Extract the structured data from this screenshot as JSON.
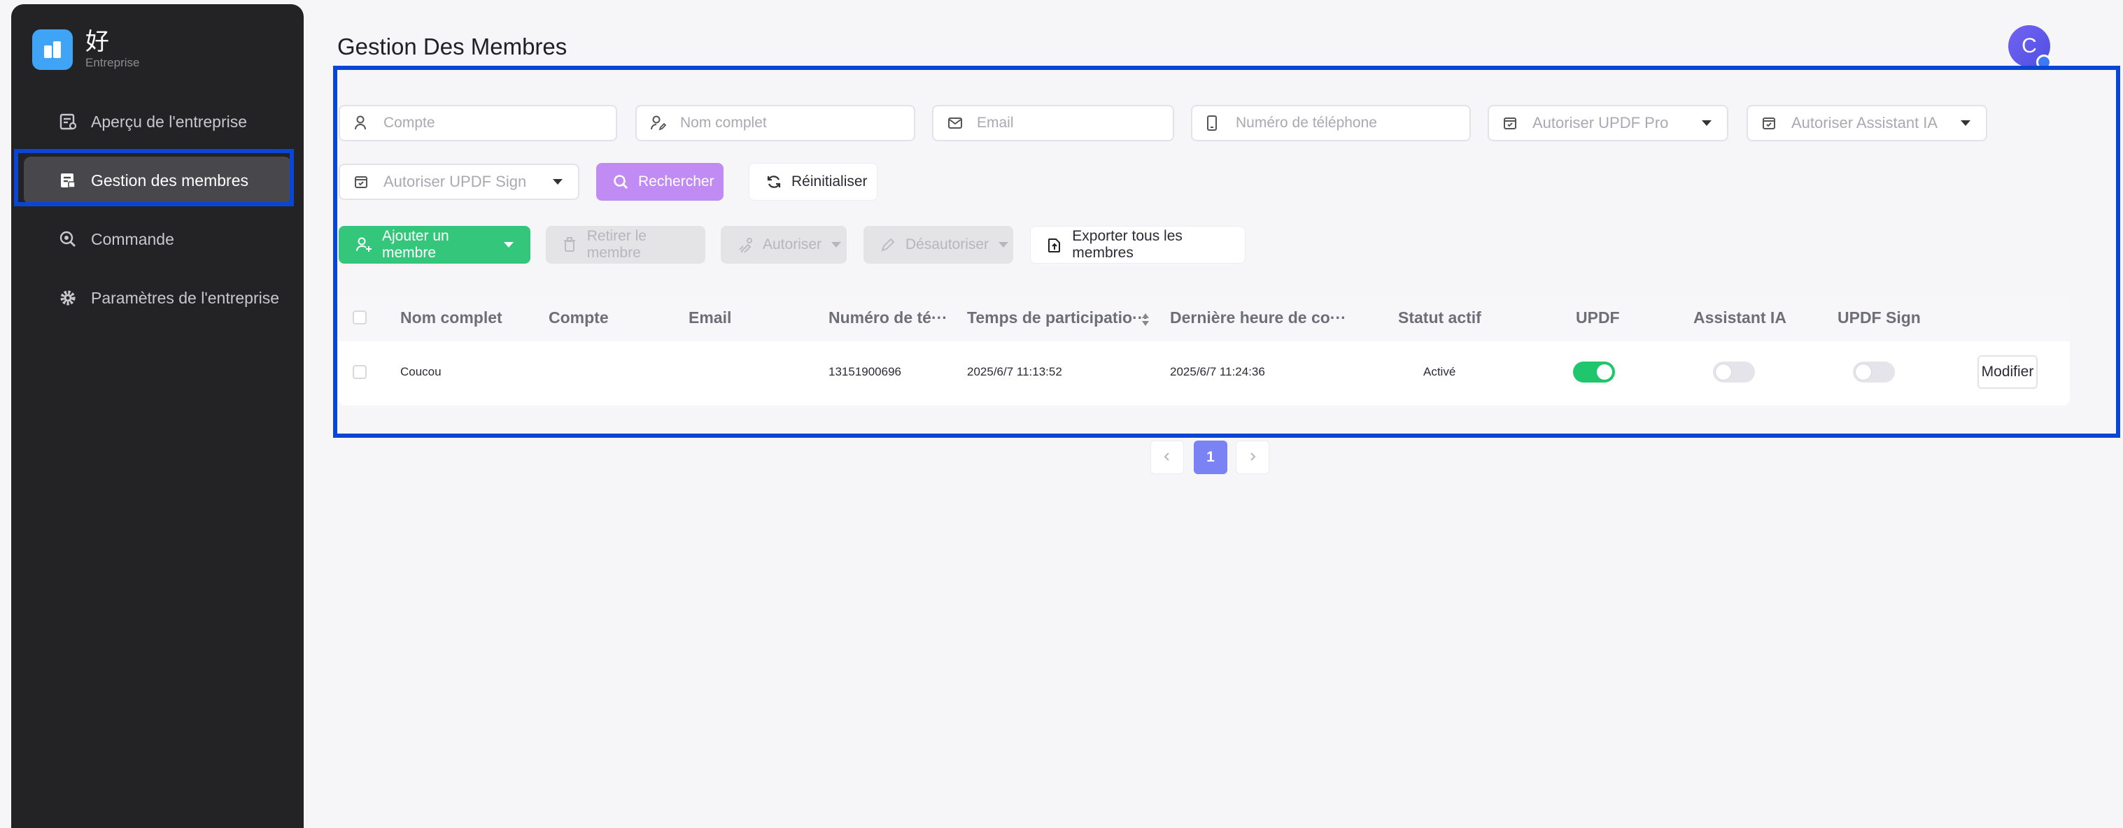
{
  "sidebar": {
    "logo": {
      "name": "好",
      "sub": "Entreprise"
    },
    "items": [
      {
        "label": "Aperçu de l'entreprise",
        "icon": "dashboard-icon"
      },
      {
        "label": "Gestion des membres",
        "icon": "members-icon",
        "active": true
      },
      {
        "label": "Commande",
        "icon": "order-search-icon"
      },
      {
        "label": "Paramètres de l'entreprise",
        "icon": "gear-icon"
      }
    ]
  },
  "header": {
    "title": "Gestion Des Membres",
    "avatar_initial": "C"
  },
  "filters": {
    "account_placeholder": "Compte",
    "fullname_placeholder": "Nom complet",
    "email_placeholder": "Email",
    "phone_placeholder": "Numéro de téléphone",
    "updf_pro": "Autoriser UPDF Pro",
    "ai_assistant": "Autoriser Assistant IA",
    "updf_sign": "Autoriser UPDF Sign",
    "search_label": "Rechercher",
    "reset_label": "Réinitialiser"
  },
  "actions": {
    "add_member": "Ajouter un membre",
    "remove_member": "Retirer le membre",
    "authorize": "Autoriser",
    "deauthorize": "Désautoriser",
    "export_all": "Exporter tous les membres"
  },
  "table": {
    "columns": {
      "fullname": "Nom complet",
      "account": "Compte",
      "email": "Email",
      "phone": "Numéro de té···",
      "join_time": "Temps de participatio···",
      "last_login": "Dernière heure de co···",
      "status": "Statut actif",
      "updf": "UPDF",
      "ai": "Assistant IA",
      "sign": "UPDF Sign"
    },
    "rows": [
      {
        "fullname": "Coucou",
        "account": "",
        "email": "",
        "phone": "13151900696",
        "join_time": "2025/6/7 11:13:52",
        "last_login": "2025/6/7 11:24:36",
        "status": "Activé",
        "updf": true,
        "ai": false,
        "sign": false,
        "edit_label": "Modifier"
      }
    ]
  },
  "pagination": {
    "current": "1"
  },
  "colors": {
    "accent": "#7b82f3",
    "green": "#34c77b",
    "purple": "#c08cf4",
    "highlight": "#0a46d6"
  }
}
